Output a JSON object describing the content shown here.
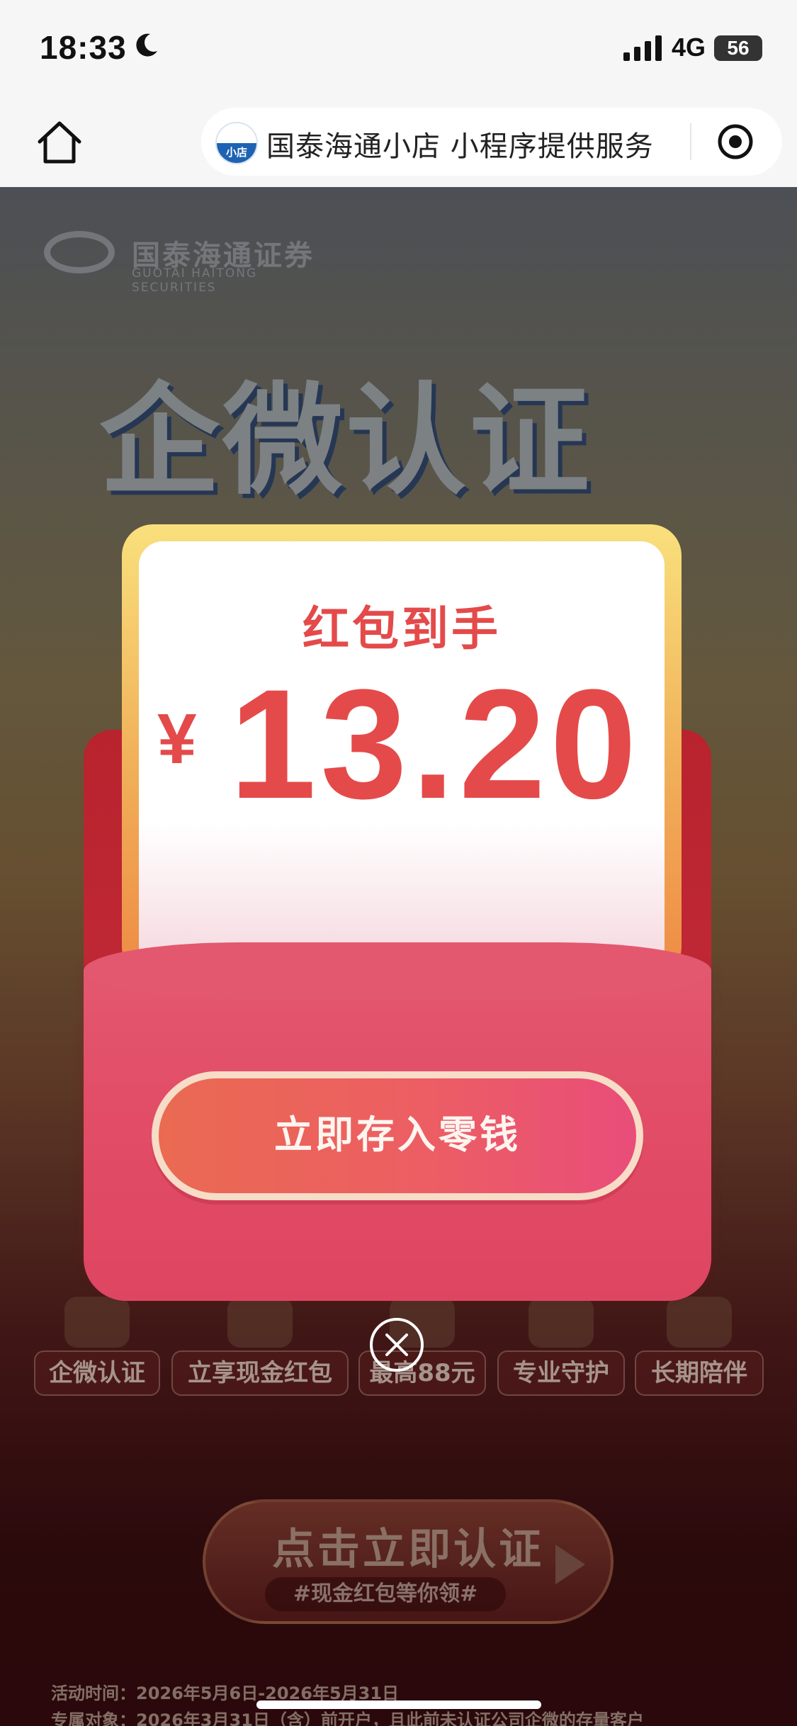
{
  "status_bar": {
    "time": "18:33",
    "network": "4G",
    "battery": "56"
  },
  "nav_bar": {
    "mini_program_logo_text": "小店",
    "mini_program_title": "国泰海通小店 小程序提供服务"
  },
  "background": {
    "brand_name_cn": "国泰海通证券",
    "brand_name_en": "GUOTAI HAITONG SECURITIES",
    "hero_title": "企微认证",
    "features": [
      "企微认证",
      "立享现金红包",
      "最高88元",
      "专业守护",
      "长期陪伴"
    ],
    "cta_label": "点击立即认证",
    "cta_sublabel": "#现金红包等你领#",
    "activity_time": "活动时间：2026年5月6日-2026年5月31日",
    "target_users": "专属对象：2026年3月31日（含）前开户，且此前未认证公司企微的存量客户"
  },
  "red_packet": {
    "title": "红包到手",
    "currency": "¥",
    "amount": "13.20",
    "action_label": "立即存入零钱"
  },
  "colors": {
    "packet_red": "#e24d67",
    "amount_red": "#e54a4a",
    "gold": "#f1b25b"
  }
}
